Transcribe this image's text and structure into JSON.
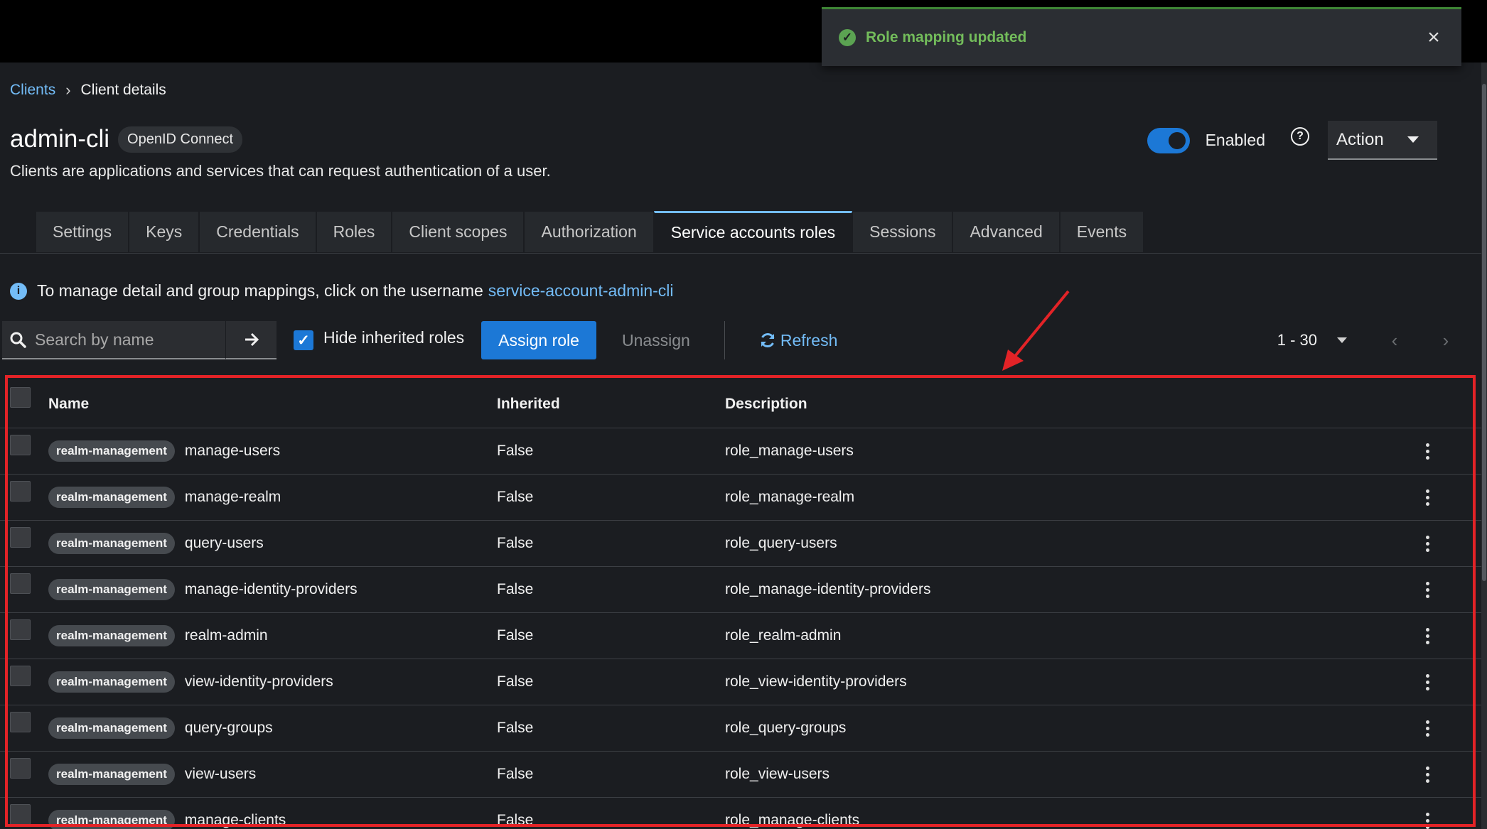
{
  "toast": {
    "message": "Role mapping updated",
    "close": "×"
  },
  "breadcrumb": {
    "parent": "Clients",
    "separator": "›",
    "current": "Client details"
  },
  "client": {
    "name": "admin-cli",
    "protocol_badge": "OpenID Connect",
    "description": "Clients are applications and services that can request authentication of a user.",
    "enabled_label": "Enabled",
    "enabled": true,
    "help": "?",
    "action_label": "Action"
  },
  "tabs": [
    "Settings",
    "Keys",
    "Credentials",
    "Roles",
    "Client scopes",
    "Authorization",
    "Service accounts roles",
    "Sessions",
    "Advanced",
    "Events"
  ],
  "active_tab": "Service accounts roles",
  "info": {
    "icon": "i",
    "text": "To manage detail and group mappings, click on the username",
    "link": "service-account-admin-cli"
  },
  "toolbar": {
    "search_placeholder": "Search by name",
    "hide_inherited_label": "Hide inherited roles",
    "hide_inherited_checked": true,
    "check_glyph": "✓",
    "assign_label": "Assign role",
    "unassign_label": "Unassign",
    "refresh_label": "Refresh",
    "pagination": "1 - 30",
    "prev": "‹",
    "next": "›"
  },
  "table": {
    "headers": {
      "name": "Name",
      "inherited": "Inherited",
      "description": "Description"
    },
    "rows": [
      {
        "client": "realm-management",
        "role": "manage-users",
        "inherited": "False",
        "description": "role_manage-users"
      },
      {
        "client": "realm-management",
        "role": "manage-realm",
        "inherited": "False",
        "description": "role_manage-realm"
      },
      {
        "client": "realm-management",
        "role": "query-users",
        "inherited": "False",
        "description": "role_query-users"
      },
      {
        "client": "realm-management",
        "role": "manage-identity-providers",
        "inherited": "False",
        "description": "role_manage-identity-providers"
      },
      {
        "client": "realm-management",
        "role": "realm-admin",
        "inherited": "False",
        "description": "role_realm-admin"
      },
      {
        "client": "realm-management",
        "role": "view-identity-providers",
        "inherited": "False",
        "description": "role_view-identity-providers"
      },
      {
        "client": "realm-management",
        "role": "query-groups",
        "inherited": "False",
        "description": "role_query-groups"
      },
      {
        "client": "realm-management",
        "role": "view-users",
        "inherited": "False",
        "description": "role_view-users"
      },
      {
        "client": "realm-management",
        "role": "manage-clients",
        "inherited": "False",
        "description": "role_manage-clients"
      }
    ]
  },
  "colors": {
    "accent": "#1c78d6",
    "link": "#73bcf7",
    "success": "#73bc5b",
    "annotation": "#e32327"
  }
}
